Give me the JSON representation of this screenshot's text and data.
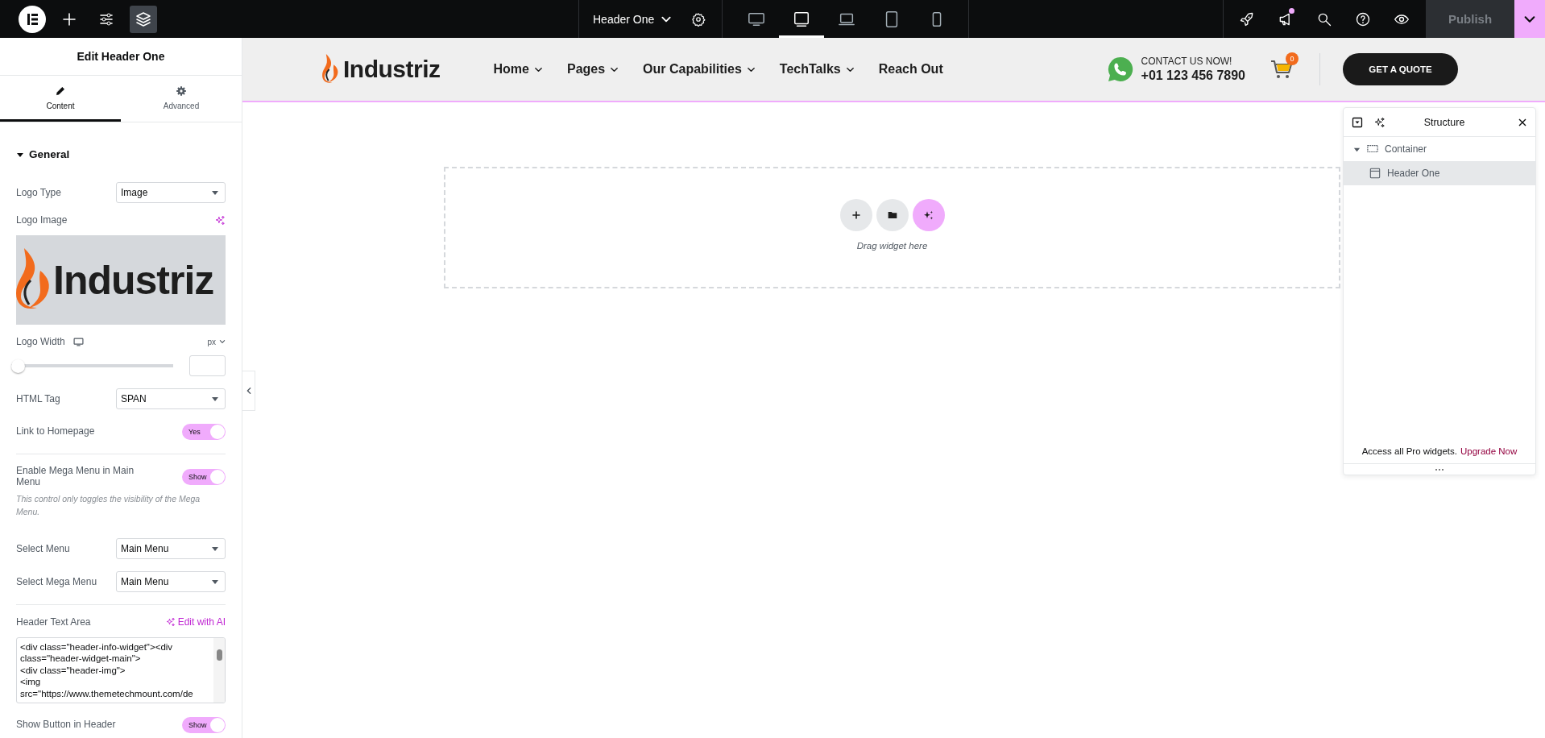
{
  "topbar": {
    "tools": [
      {
        "kind": "logo",
        "selected": false
      },
      {
        "kind": "add",
        "selected": false
      },
      {
        "kind": "settings",
        "selected": false
      },
      {
        "kind": "structure",
        "selected": true
      }
    ],
    "document_title": "Header One",
    "devices": [
      {
        "kind": "desktop",
        "selected": false
      },
      {
        "kind": "tablet_landscape",
        "selected": true
      },
      {
        "kind": "laptop",
        "selected": false
      },
      {
        "kind": "tablet",
        "selected": false
      },
      {
        "kind": "mobile",
        "selected": false
      }
    ],
    "actions": [
      {
        "kind": "launch",
        "unread": false
      },
      {
        "kind": "announcements",
        "unread": true
      },
      {
        "kind": "search",
        "unread": false
      },
      {
        "kind": "help",
        "unread": false
      },
      {
        "kind": "preview",
        "unread": false
      }
    ],
    "publish": {
      "label": "Publish",
      "disabled": true
    }
  },
  "panel": {
    "title": "Edit Header One",
    "tabs": [
      {
        "kind": "content",
        "label": "Content",
        "selected": true
      },
      {
        "kind": "advanced",
        "label": "Advanced",
        "selected": false
      }
    ],
    "section": {
      "title": "General",
      "expanded": true
    },
    "controls": [
      {
        "kind": "select",
        "label": "Logo Type",
        "value": "Image"
      },
      {
        "kind": "image",
        "label": "Logo Image",
        "logo_text": "Industriz"
      },
      {
        "kind": "slider",
        "label": "Logo Width",
        "unit": "px",
        "level": 0
      },
      {
        "kind": "select",
        "label": "HTML Tag",
        "value": "SPAN"
      },
      {
        "kind": "toggle",
        "label": "Link to Homepage",
        "on": true,
        "state_label": "Yes"
      },
      {
        "kind": "divider"
      },
      {
        "kind": "toggle",
        "label": "Enable Mega Menu in Main Menu",
        "on": true,
        "state_label": "Show",
        "description": "This control only toggles the visibility of the Mega Menu."
      },
      {
        "kind": "select",
        "label": "Select Menu",
        "value": "Main Menu"
      },
      {
        "kind": "select",
        "label": "Select Mega Menu",
        "value": "Main Menu"
      },
      {
        "kind": "divider"
      },
      {
        "kind": "code",
        "label": "Header Text Area",
        "action": "Edit with AI",
        "value": "<div class=\"header-info-widget\"><div class=\"header-widget-main\">\n<div class=\"header-img\">\n<img\nsrc=\"https://www.themetechmount.com/de"
      },
      {
        "kind": "toggle",
        "label": "Show Button in Header",
        "on": true,
        "state_label": "Show"
      }
    ]
  },
  "preview": {
    "logo_text": "Industriz",
    "nav": [
      {
        "label": "Home",
        "has_dropdown": true
      },
      {
        "label": "Pages",
        "has_dropdown": true
      },
      {
        "label": "Our Capabilities",
        "has_dropdown": true
      },
      {
        "label": "TechTalks",
        "has_dropdown": true
      },
      {
        "label": "Reach Out",
        "has_dropdown": false
      }
    ],
    "contact_label": "CONTACT US NOW!",
    "phone": "+01 123 456 7890",
    "cart_count": "0",
    "cta": "GET A QUOTE",
    "dropzone": {
      "text": "Drag widget here",
      "buttons": [
        {
          "kind": "add"
        },
        {
          "kind": "template"
        },
        {
          "kind": "ai"
        }
      ]
    }
  },
  "structure": {
    "title": "Structure",
    "tree": [
      {
        "label": "Container",
        "kind": "container",
        "expanded": true,
        "selected": false,
        "children": [
          {
            "label": "Header One",
            "kind": "widget",
            "selected": true
          }
        ]
      }
    ],
    "footer_text": "Access all Pro widgets.",
    "footer_link": "Upgrade Now"
  }
}
